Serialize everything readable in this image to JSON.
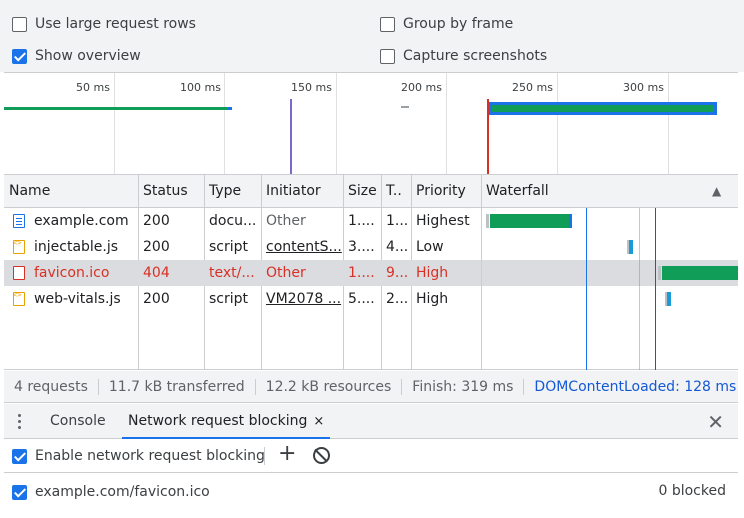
{
  "options": {
    "large_rows": "Use large request rows",
    "group_by_frame": "Group by frame",
    "show_overview": "Show overview",
    "capture_screenshots": "Capture screenshots",
    "large_rows_checked": false,
    "group_by_frame_checked": false,
    "show_overview_checked": true,
    "capture_screenshots_checked": false
  },
  "overview": {
    "ticks": [
      "50 ms",
      "100 ms",
      "150 ms",
      "200 ms",
      "250 ms",
      "300 ms"
    ]
  },
  "table": {
    "headers": {
      "name": "Name",
      "status": "Status",
      "type": "Type",
      "initiator": "Initiator",
      "size": "Size",
      "time": "T..",
      "priority": "Priority",
      "waterfall": "Waterfall",
      "sort_icon": "▲"
    },
    "rows": [
      {
        "name": "example.com",
        "status": "200",
        "type": "docu...",
        "initiator": "Other",
        "size": "1....",
        "time": "1...",
        "priority": "Highest",
        "icon": "document-icon"
      },
      {
        "name": "injectable.js",
        "status": "200",
        "type": "script",
        "initiator": "contentS...",
        "size": "3....",
        "time": "4...",
        "priority": "Low",
        "icon": "script-icon"
      },
      {
        "name": "favicon.ico",
        "status": "404",
        "type": "text/...",
        "initiator": "Other",
        "size": "1....",
        "time": "9...",
        "priority": "High",
        "icon": "image-icon"
      },
      {
        "name": "web-vitals.js",
        "status": "200",
        "type": "script",
        "initiator": "VM2078 ...",
        "size": "5....",
        "time": "2...",
        "priority": "High",
        "icon": "script-icon"
      }
    ]
  },
  "summary": {
    "requests": "4 requests",
    "transferred": "11.7 kB transferred",
    "resources": "12.2 kB resources",
    "finish": "Finish: 319 ms",
    "dcl": "DOMContentLoaded: 128 ms"
  },
  "drawer": {
    "tab_console": "Console",
    "tab_blocking": "Network request blocking",
    "tab_close": "×",
    "close": "✕"
  },
  "blocking": {
    "enable_label": "Enable network request blocking",
    "enable_checked": true,
    "add_icon": "+",
    "clear_icon": "⃠",
    "pattern": "example.com/favicon.ico",
    "pattern_checked": true,
    "blocked_count": "0 blocked"
  },
  "colors": {
    "accent": "#1a73e8",
    "error": "#d93025",
    "bar_green": "#0f9d58",
    "dcl_blue": "#1a73e8",
    "load_red": "#c5221f",
    "fcp_purple": "#7b68c8"
  }
}
